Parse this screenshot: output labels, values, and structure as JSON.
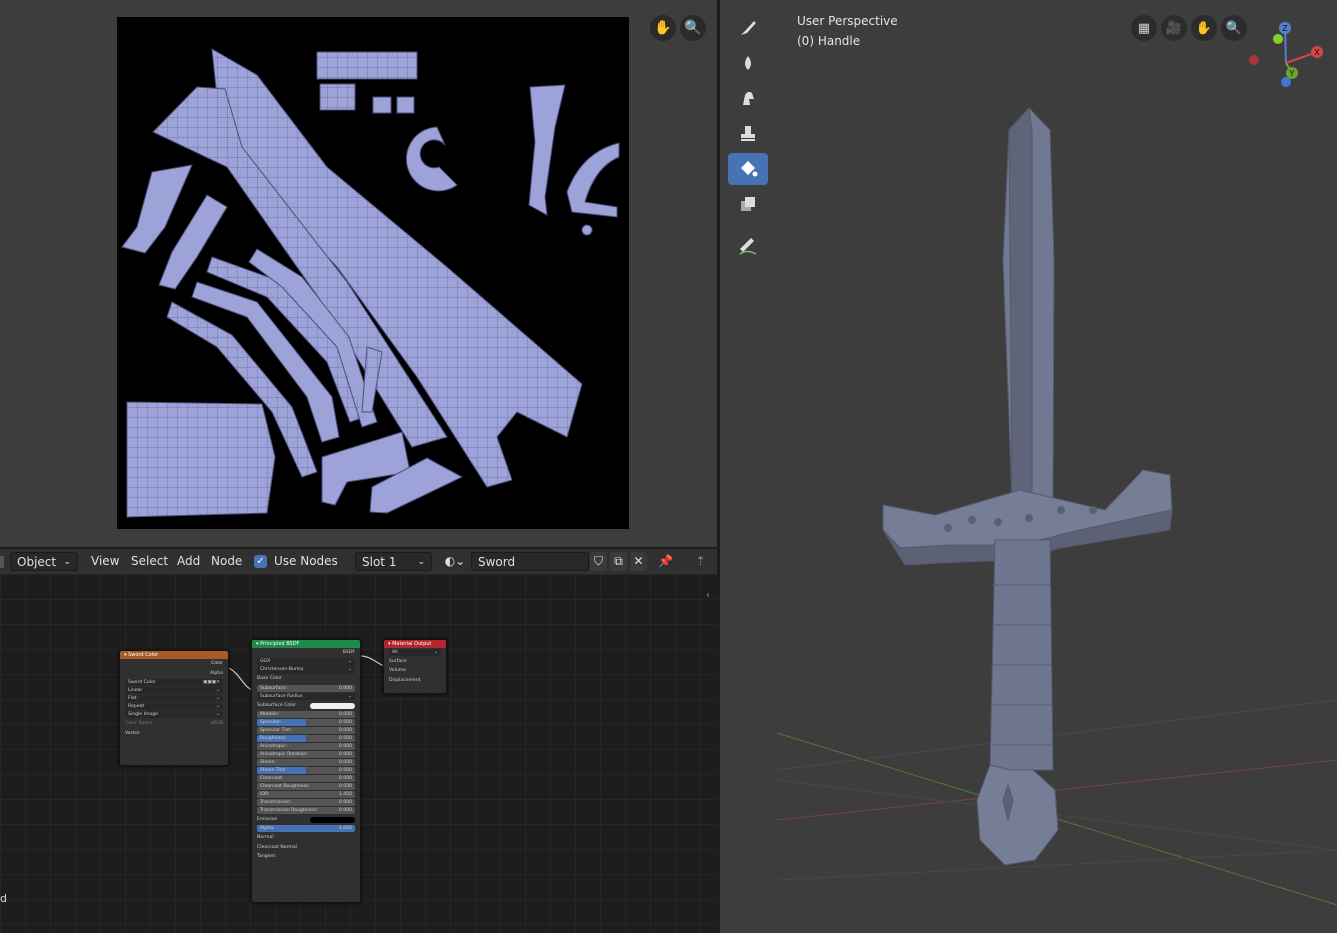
{
  "uv_editor": {
    "nav_icons": [
      "hand-icon",
      "zoom-icon"
    ]
  },
  "node_header": {
    "mode": "Object",
    "menus": [
      "View",
      "Select",
      "Add",
      "Node"
    ],
    "use_nodes_label": "Use Nodes",
    "use_nodes_checked": true,
    "slot": "Slot 1",
    "material_name": "Sword"
  },
  "nodes": {
    "image": {
      "title": "Sword Color",
      "outputs": [
        "Color",
        "Alpha"
      ],
      "image_name": "Sword Color",
      "interpolation": "Linear",
      "projection": "Flat",
      "extension": "Repeat",
      "source": "Single Image",
      "color_space_label": "Color Space",
      "color_space": "sRGB",
      "vector": "Vector"
    },
    "bsdf": {
      "title": "Principled BSDF",
      "output": "BSDF",
      "distribution": "GGX",
      "subsurface_method": "Christensen-Burley",
      "base_color": "Base Color",
      "fields": [
        {
          "label": "Subsurface:",
          "value": "0.000",
          "style": ""
        },
        {
          "label": "Subsurface Radius",
          "value": "",
          "style": "select"
        },
        {
          "label": "Subsurface Color",
          "value": "",
          "style": "color"
        },
        {
          "label": "Metallic:",
          "value": "0.000",
          "style": ""
        },
        {
          "label": "Specular:",
          "value": "0.500",
          "style": "blue"
        },
        {
          "label": "Specular Tint:",
          "value": "0.000",
          "style": ""
        },
        {
          "label": "Roughness:",
          "value": "0.500",
          "style": "blue"
        },
        {
          "label": "Anisotropic:",
          "value": "0.000",
          "style": ""
        },
        {
          "label": "Anisotropic Rotation:",
          "value": "0.000",
          "style": ""
        },
        {
          "label": "Sheen:",
          "value": "0.000",
          "style": ""
        },
        {
          "label": "Sheen Tint:",
          "value": "0.500",
          "style": "blue"
        },
        {
          "label": "Clearcoat:",
          "value": "0.000",
          "style": ""
        },
        {
          "label": "Clearcoat Roughness:",
          "value": "0.030",
          "style": ""
        },
        {
          "label": "IOR:",
          "value": "1.450",
          "style": ""
        },
        {
          "label": "Transmission:",
          "value": "0.000",
          "style": ""
        },
        {
          "label": "Transmission Roughness:",
          "value": "0.000",
          "style": ""
        },
        {
          "label": "Emission",
          "value": "",
          "style": "black"
        },
        {
          "label": "Alpha:",
          "value": "1.000",
          "style": "blue-full"
        }
      ],
      "inputs": [
        "Normal",
        "Clearcoat Normal",
        "Tangent"
      ]
    },
    "output": {
      "title": "Material Output",
      "target": "All",
      "inputs": [
        "Surface",
        "Volume",
        "Displacement"
      ]
    }
  },
  "viewport": {
    "title": "User Perspective",
    "subtitle": "(0) Handle",
    "tools": [
      "brush-icon",
      "smear-icon",
      "smudge-icon",
      "clone-stamp-icon",
      "fill-icon",
      "mask-icon",
      "annotate-icon"
    ],
    "active_tool": 4,
    "nav_icons": [
      "ortho-grid-icon",
      "camera-icon",
      "hand-icon",
      "zoom-icon"
    ],
    "gizmo": {
      "z": "Z",
      "x": "X",
      "y": "Y"
    }
  },
  "colors": {
    "accent": "#4772b3",
    "uv_face": "#9da3d8",
    "mesh": "#6b7288",
    "image_node_header": "#a85b26",
    "bsdf_header": "#1e8a4a",
    "output_header": "#b4262d"
  }
}
